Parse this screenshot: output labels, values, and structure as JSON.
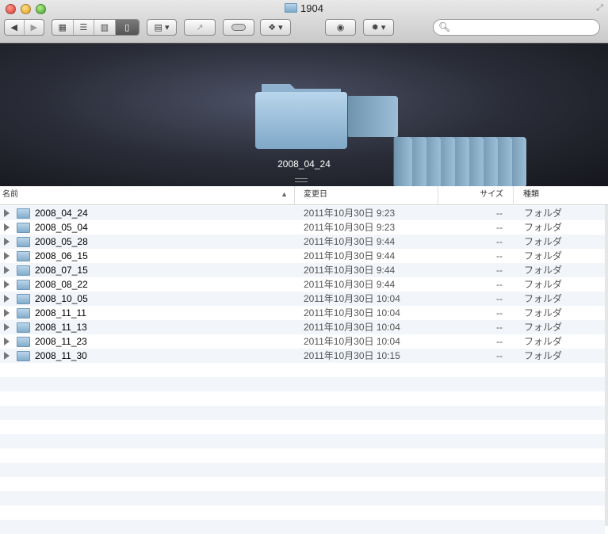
{
  "window": {
    "title": "1904"
  },
  "toolbar": {
    "search_placeholder": "",
    "search_icon": "search-icon"
  },
  "coverflow": {
    "selected_label": "2008_04_24"
  },
  "columns": {
    "name": "名前",
    "modified": "変更日",
    "size": "サイズ",
    "kind": "種類"
  },
  "rows": [
    {
      "name": "2008_04_24",
      "date": "2011年10月30日 9:23",
      "size": "--",
      "kind": "フォルダ"
    },
    {
      "name": "2008_05_04",
      "date": "2011年10月30日 9:23",
      "size": "--",
      "kind": "フォルダ"
    },
    {
      "name": "2008_05_28",
      "date": "2011年10月30日 9:44",
      "size": "--",
      "kind": "フォルダ"
    },
    {
      "name": "2008_06_15",
      "date": "2011年10月30日 9:44",
      "size": "--",
      "kind": "フォルダ"
    },
    {
      "name": "2008_07_15",
      "date": "2011年10月30日 9:44",
      "size": "--",
      "kind": "フォルダ"
    },
    {
      "name": "2008_08_22",
      "date": "2011年10月30日 9:44",
      "size": "--",
      "kind": "フォルダ"
    },
    {
      "name": "2008_10_05",
      "date": "2011年10月30日 10:04",
      "size": "--",
      "kind": "フォルダ"
    },
    {
      "name": "2008_11_11",
      "date": "2011年10月30日 10:04",
      "size": "--",
      "kind": "フォルダ"
    },
    {
      "name": "2008_11_13",
      "date": "2011年10月30日 10:04",
      "size": "--",
      "kind": "フォルダ"
    },
    {
      "name": "2008_11_23",
      "date": "2011年10月30日 10:04",
      "size": "--",
      "kind": "フォルダ"
    },
    {
      "name": "2008_11_30",
      "date": "2011年10月30日 10:15",
      "size": "--",
      "kind": "フォルダ"
    }
  ]
}
